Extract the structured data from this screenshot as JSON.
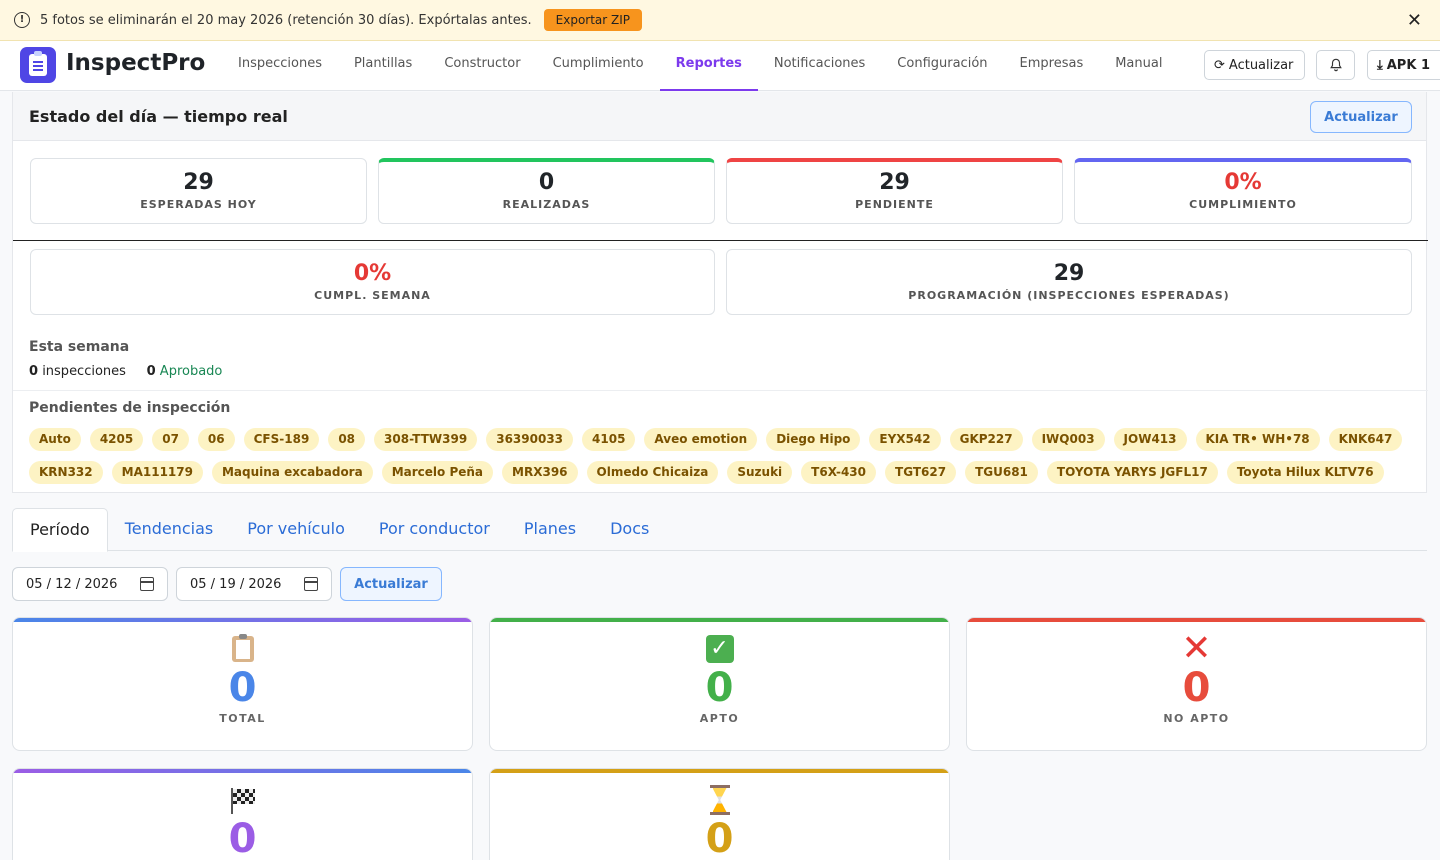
{
  "banner": {
    "message": "5 fotos se eliminarán el 20 may 2026 (retención 30 días). Expórtalas antes.",
    "export_label": "Exportar ZIP",
    "close_symbol": "✕"
  },
  "navbar": {
    "brand": "InspectPro",
    "items": [
      {
        "label": "Inspecciones"
      },
      {
        "label": "Plantillas"
      },
      {
        "label": "Constructor"
      },
      {
        "label": "Cumplimiento"
      },
      {
        "label": "Reportes"
      },
      {
        "label": "Notificaciones"
      },
      {
        "label": "Configuración"
      },
      {
        "label": "Empresas"
      },
      {
        "label": "Manual"
      }
    ],
    "active": "Reportes",
    "refresh_label": "Actualizar",
    "apk_label": "APK 1"
  },
  "live": {
    "title": "Estado del día — tiempo real",
    "refresh_label": "Actualizar",
    "kpis": [
      {
        "value": "29",
        "label": "ESPERADAS HOY",
        "color": "#212529",
        "accent": ""
      },
      {
        "value": "0",
        "label": "REALIZADAS",
        "color": "#212529",
        "accent": "#22c55e"
      },
      {
        "value": "29",
        "label": "PENDIENTE",
        "color": "#212529",
        "accent": "#ef4444"
      },
      {
        "value": "0%",
        "label": "CUMPLIMIENTO",
        "color": "#e53935",
        "accent": "#6366f1"
      }
    ],
    "kpis2": [
      {
        "value": "0%",
        "label": "CUMPL. SEMANA",
        "color": "#e53935"
      },
      {
        "value": "29",
        "label": "PROGRAMACIÓN (INSPECCIONES ESPERADAS)",
        "color": "#212529"
      }
    ],
    "week": {
      "title": "Esta semana",
      "inspections_count": "0",
      "inspections_label": "inspecciones",
      "approved_count": "0",
      "approved_label": "Aprobado"
    },
    "pending": {
      "title": "Pendientes de inspección",
      "items": [
        "Auto",
        "4205",
        "07",
        "06",
        "CFS-189",
        "08",
        "308-TTW399",
        "36390033",
        "4105",
        "Aveo emotion",
        "Diego Hipo",
        "EYX542",
        "GKP227",
        "IWQ003",
        "JOW413",
        "KIA TR• WH•78",
        "KNK647",
        "KRN332",
        "MA111179",
        "Maquina excabadora",
        "Marcelo Peña",
        "MRX396",
        "Olmedo Chicaiza",
        "Suzuki",
        "T6X-430",
        "TGT627",
        "TGU681",
        "TOYOTA YARYS JGFL17",
        "Toyota Hilux KLTV76"
      ]
    }
  },
  "tabs": [
    {
      "label": "Período"
    },
    {
      "label": "Tendencias"
    },
    {
      "label": "Por vehículo"
    },
    {
      "label": "Por conductor"
    },
    {
      "label": "Planes"
    },
    {
      "label": "Docs"
    }
  ],
  "active_tab": "Período",
  "period": {
    "start_date": "05 / 12 / 2026",
    "end_date": "05 / 19 / 2026",
    "refresh_label": "Actualizar"
  },
  "stats": [
    {
      "icon": "clipboard-icon",
      "value": "0",
      "label": "TOTAL",
      "color": "#4a86e8"
    },
    {
      "icon": "check-icon",
      "value": "0",
      "label": "APTO",
      "color": "#43b04a"
    },
    {
      "icon": "cross-icon",
      "value": "0",
      "label": "NO APTO",
      "color": "#e74c3c"
    },
    {
      "icon": "checkered-flag-icon",
      "value": "0",
      "label": "",
      "color": "#9b5de5"
    },
    {
      "icon": "hourglass-icon",
      "value": "0",
      "label": "",
      "color": "#d4a017"
    }
  ]
}
